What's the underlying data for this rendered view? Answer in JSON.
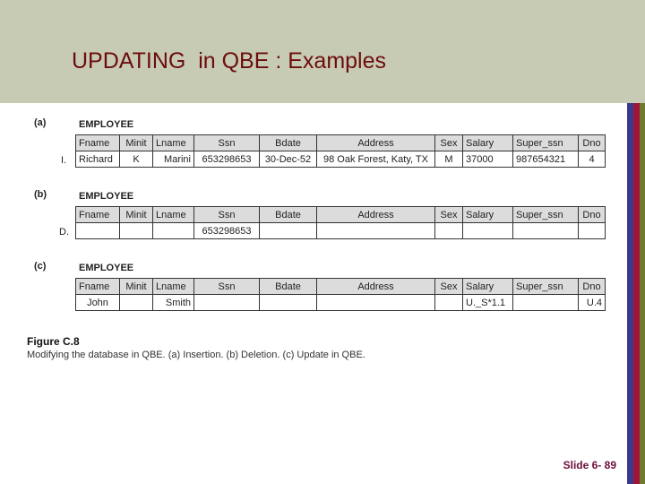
{
  "slide": {
    "title": "UPDATING  in QBE : Examples",
    "slide_number": "Slide 6- 89"
  },
  "colors": {
    "header_bg": "#c8cbb3",
    "title_color": "#6b0d0d",
    "stripe_blue": "#3a3a8c",
    "stripe_red": "#a0143a",
    "stripe_olive": "#6f7a2e"
  },
  "columns": [
    "Fname",
    "Minit",
    "Lname",
    "Ssn",
    "Bdate",
    "Address",
    "Sex",
    "Salary",
    "Super_ssn",
    "Dno"
  ],
  "sections": [
    {
      "label": "(a)",
      "table_name": "EMPLOYEE",
      "row_prefix": "I.",
      "row": [
        "Richard",
        "K",
        "Marini",
        "653298653",
        "30-Dec-52",
        "98 Oak Forest, Katy, TX",
        "M",
        "37000",
        "987654321",
        "4"
      ]
    },
    {
      "label": "(b)",
      "table_name": "EMPLOYEE",
      "row_prefix": "D.",
      "row": [
        "",
        "",
        "",
        "653298653",
        "",
        "",
        "",
        "",
        "",
        ""
      ]
    },
    {
      "label": "(c)",
      "table_name": "EMPLOYEE",
      "row_prefix": "",
      "row": [
        "John",
        "",
        "Smith",
        "",
        "",
        "",
        "",
        "U._S*1.1",
        "",
        "U.4"
      ]
    }
  ],
  "figure": {
    "title": "Figure C.8",
    "caption": "Modifying the database in QBE. (a) Insertion. (b) Deletion. (c) Update in QBE."
  }
}
